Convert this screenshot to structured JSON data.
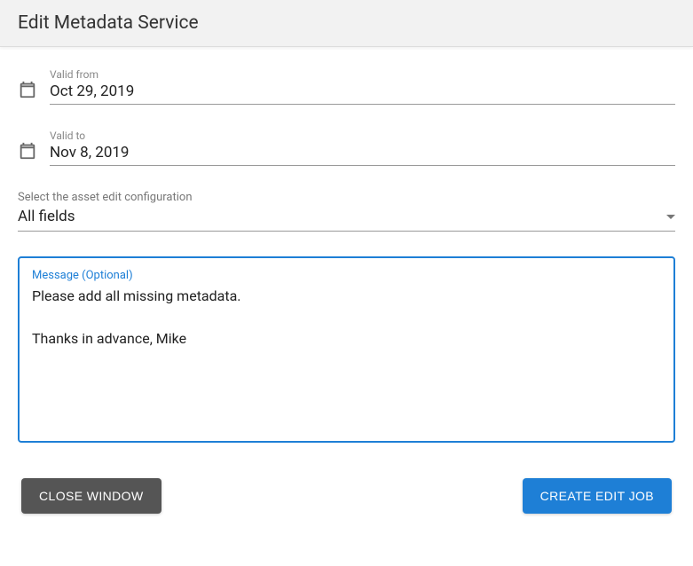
{
  "header": {
    "title": "Edit Metadata Service"
  },
  "form": {
    "valid_from": {
      "label": "Valid from",
      "value": "Oct 29, 2019"
    },
    "valid_to": {
      "label": "Valid to",
      "value": "Nov 8, 2019"
    },
    "config_select": {
      "label": "Select the asset edit configuration",
      "value": "All fields"
    },
    "message": {
      "label": "Message (Optional)",
      "value": "Please add all missing metadata.\n\nThanks in advance, Mike"
    }
  },
  "footer": {
    "close_label": "CLOSE WINDOW",
    "create_label": "CREATE EDIT JOB"
  }
}
